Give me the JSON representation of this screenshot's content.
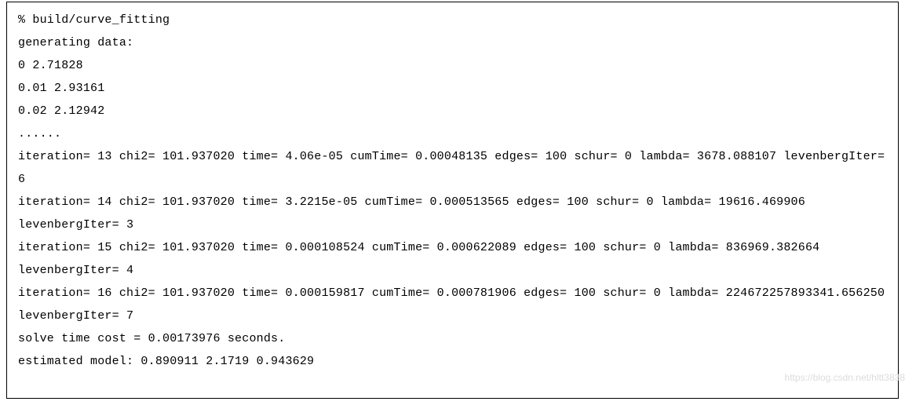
{
  "lines": [
    "% build/curve_fitting",
    "generating data:",
    "0 2.71828",
    "0.01 2.93161",
    "0.02 2.12942",
    "......",
    "iteration= 13 chi2= 101.937020 time= 4.06e-05 cumTime= 0.00048135 edges= 100 schur= 0 lambda= 3678.088107 levenbergIter= 6",
    "iteration= 14 chi2= 101.937020 time= 3.2215e-05 cumTime= 0.000513565 edges= 100 schur= 0 lambda= 19616.469906 levenbergIter= 3",
    "iteration= 15 chi2= 101.937020 time= 0.000108524 cumTime= 0.000622089 edges= 100 schur= 0 lambda= 836969.382664 levenbergIter= 4",
    "iteration= 16 chi2= 101.937020 time= 0.000159817 cumTime= 0.000781906 edges= 100 schur= 0 lambda= 224672257893341.656250 levenbergIter= 7",
    "solve time cost = 0.00173976 seconds.",
    "estimated model: 0.890911 2.1719 0.943629"
  ],
  "watermark": "https://blog.csdn.net/hltt3838"
}
